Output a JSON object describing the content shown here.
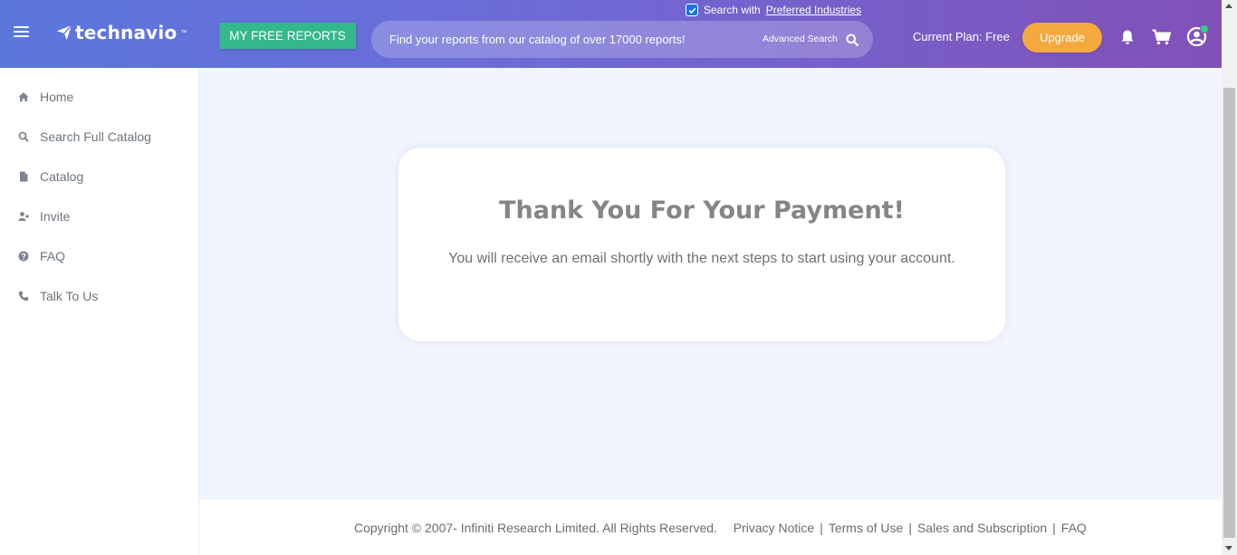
{
  "header": {
    "logo_text": "technavio",
    "logo_tm": "™",
    "free_reports_label": "MY FREE REPORTS",
    "preferred_prefix": "Search with",
    "preferred_link": "Preferred Industries",
    "preferred_checked": true,
    "search_placeholder": "Find your reports from our catalog of over 17000 reports!",
    "advanced_search_label": "Advanced Search",
    "plan_label": "Current Plan: Free",
    "upgrade_label": "Upgrade",
    "icons": [
      "hamburger-icon",
      "search-icon",
      "bell-icon",
      "cart-icon",
      "user-icon"
    ]
  },
  "sidebar": {
    "items": [
      {
        "label": "Home",
        "icon": "home-icon"
      },
      {
        "label": "Search Full Catalog",
        "icon": "search-icon"
      },
      {
        "label": "Catalog",
        "icon": "file-icon"
      },
      {
        "label": "Invite",
        "icon": "user-plus-icon"
      },
      {
        "label": "FAQ",
        "icon": "question-icon"
      },
      {
        "label": "Talk To Us",
        "icon": "phone-icon"
      }
    ]
  },
  "main": {
    "title": "Thank You For Your Payment!",
    "message": "You will receive an email shortly with the next steps to start using your account."
  },
  "footer": {
    "copyright": "Copyright © 2007- Infiniti Research Limited. All Rights Reserved.",
    "links": [
      "Privacy Notice",
      "Terms of Use",
      "Sales and Subscription",
      "FAQ"
    ]
  },
  "colors": {
    "header_gradient_start": "#5b77dc",
    "header_gradient_end": "#8151b8",
    "free_reports_button": "#33b78c",
    "upgrade_button": "#f3a93d",
    "page_background": "#f1f5fd",
    "online_status": "#2fd37d"
  }
}
